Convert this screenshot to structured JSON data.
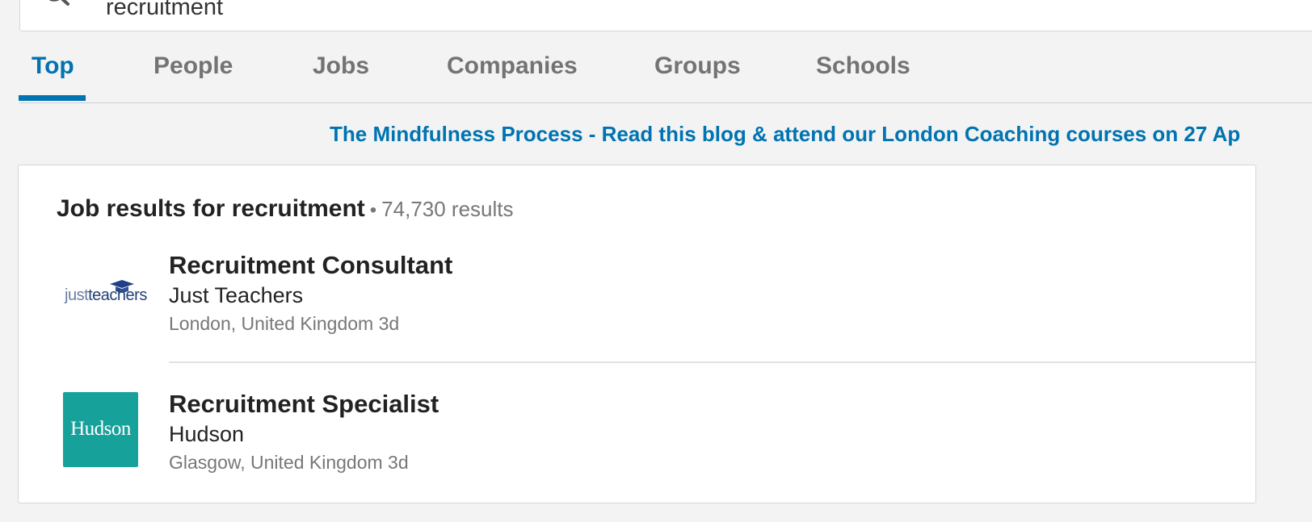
{
  "search": {
    "query": "recruitment",
    "icon": "search-icon"
  },
  "tabs": [
    {
      "label": "Top",
      "active": true
    },
    {
      "label": "People",
      "active": false
    },
    {
      "label": "Jobs",
      "active": false
    },
    {
      "label": "Companies",
      "active": false
    },
    {
      "label": "Groups",
      "active": false
    },
    {
      "label": "Schools",
      "active": false
    }
  ],
  "ad": {
    "text": "The Mindfulness Process - Read this blog & attend our London Coaching courses on 27 Ap"
  },
  "results": {
    "title": "Job results for recruitment",
    "separator": "•",
    "count": "74,730 results",
    "jobs": [
      {
        "title": "Recruitment Consultant",
        "company": "Just Teachers",
        "meta": "London, United Kingdom 3d",
        "logo": {
          "name": "justteachers-logo",
          "just": "just",
          "teachers": "teachers"
        }
      },
      {
        "title": "Recruitment Specialist",
        "company": "Hudson",
        "meta": "Glasgow, United Kingdom 3d",
        "logo": {
          "name": "hudson-logo",
          "text": "Hudson",
          "color": "#17a19b"
        }
      }
    ]
  },
  "colors": {
    "accent": "#0073b1",
    "background": "#f3f3f3",
    "text": "#222222",
    "muted": "#777777"
  }
}
